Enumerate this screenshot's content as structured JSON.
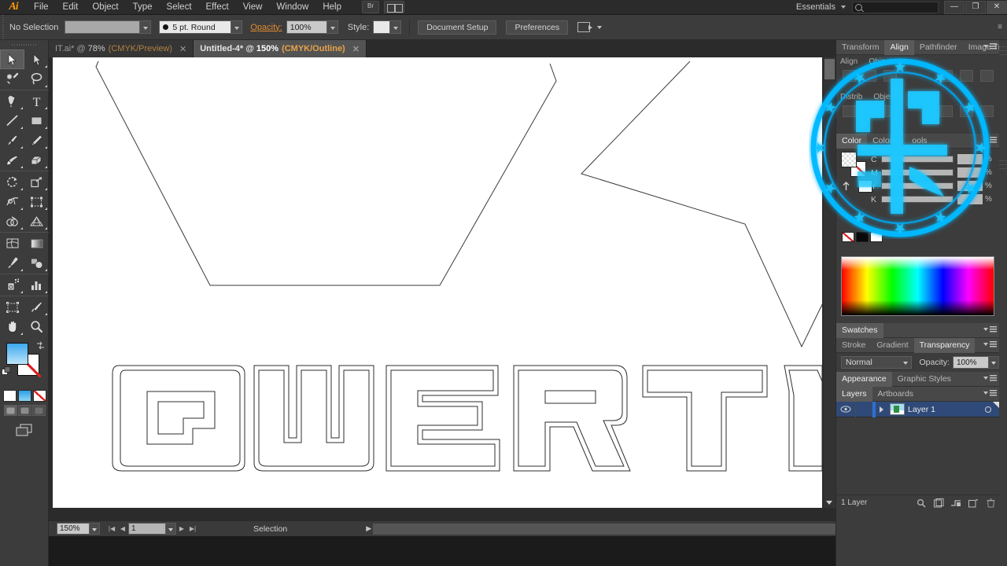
{
  "app": {
    "name": "Adobe Illustrator",
    "logo": "Ai"
  },
  "menubar": {
    "items": [
      "File",
      "Edit",
      "Object",
      "Type",
      "Select",
      "Effect",
      "View",
      "Window",
      "Help"
    ],
    "bridge_label": "Br",
    "workspace": "Essentials",
    "search_placeholder": "",
    "window_buttons": {
      "minimize": "—",
      "restore": "❐",
      "close": "✕"
    }
  },
  "control_bar": {
    "selection_status": "No Selection",
    "stroke_profile": "5 pt. Round",
    "opacity_label": "Opacity:",
    "opacity_value": "100%",
    "style_label": "Style:",
    "document_setup": "Document Setup",
    "preferences": "Preferences"
  },
  "toolbar": {
    "tools": [
      "selection-tool",
      "direct-selection-tool",
      "magic-wand-tool",
      "lasso-tool",
      "pen-tool",
      "type-tool",
      "line-segment-tool",
      "rectangle-tool",
      "paintbrush-tool",
      "pencil-tool",
      "blob-brush-tool",
      "eraser-tool",
      "rotate-tool",
      "scale-tool",
      "width-tool",
      "free-transform-tool",
      "shape-builder-tool",
      "perspective-grid-tool",
      "mesh-tool",
      "gradient-tool",
      "eyedropper-tool",
      "blend-tool",
      "symbol-sprayer-tool",
      "column-graph-tool",
      "artboard-tool",
      "slice-tool",
      "hand-tool",
      "zoom-tool"
    ],
    "fill_label": "fill-swatch",
    "stroke_label": "stroke-swatch",
    "color_modes": [
      "color-mode",
      "gradient-mode",
      "none-mode"
    ],
    "screen_modes": [
      "normal-screen-mode",
      "full-screen-menubar",
      "full-screen-mode"
    ]
  },
  "document_tabs": [
    {
      "name": "IT.ai*",
      "zoom": "78%",
      "mode": "(CMYK/Preview)",
      "active": false,
      "close": "✕"
    },
    {
      "name": "Untitled-4*",
      "zoom": "150%",
      "mode": "(CMYK/Outline)",
      "active": true,
      "close": "✕"
    }
  ],
  "status_bar": {
    "zoom": "150%",
    "page": "1",
    "tool_status": "Selection"
  },
  "dock": {
    "align_panel": {
      "tabs": [
        "Transform",
        "Align",
        "Pathfinder",
        "Image Tr"
      ],
      "active_tab": "Align",
      "align_objects_label": "Align",
      "align_objects_to": "Objects",
      "distribute_label": "Distrib",
      "distribute_to": "Object"
    },
    "color_panel": {
      "tabs": [
        "Color",
        "Color G",
        "ools"
      ],
      "active_tab": "Color",
      "channels": [
        {
          "label": "C",
          "value": "",
          "unit": "%"
        },
        {
          "label": "M",
          "value": "",
          "unit": "%"
        },
        {
          "label": "Y",
          "value": "",
          "unit": "%"
        },
        {
          "label": "K",
          "value": "",
          "unit": "%"
        }
      ]
    },
    "swatches_panel": {
      "title": "Swatches"
    },
    "transparency_panel": {
      "tabs": [
        "Stroke",
        "Gradient",
        "Transparency"
      ],
      "active_tab": "Transparency",
      "blend_mode": "Normal",
      "opacity_label": "Opacity:",
      "opacity_value": "100%"
    },
    "appearance_panel": {
      "tabs": [
        "Appearance",
        "Graphic Styles"
      ],
      "active_tab": "Appearance"
    },
    "layers_panel": {
      "tabs": [
        "Layers",
        "Artboards"
      ],
      "active_tab": "Layers",
      "rows": [
        {
          "name": "Layer 1",
          "visible": true,
          "selected": true
        }
      ],
      "footer_count": "1 Layer",
      "footer_icons": [
        "locate-object-icon",
        "make-clipping-mask-icon",
        "create-sublayer-icon",
        "new-layer-icon",
        "delete-layer-icon"
      ]
    }
  },
  "artwork": {
    "description": "QWERT outlined lettering and angular star paths in outline view",
    "letters": "QWERT"
  },
  "colors": {
    "chrome": "#3c3c3c",
    "chrome_dark": "#2b2b2b",
    "accent_orange": "#e08a2e",
    "layer_selected": "#2f4a78",
    "watermark_cyan": "#00b8ff",
    "fill_blue": "#3aa8ee"
  }
}
